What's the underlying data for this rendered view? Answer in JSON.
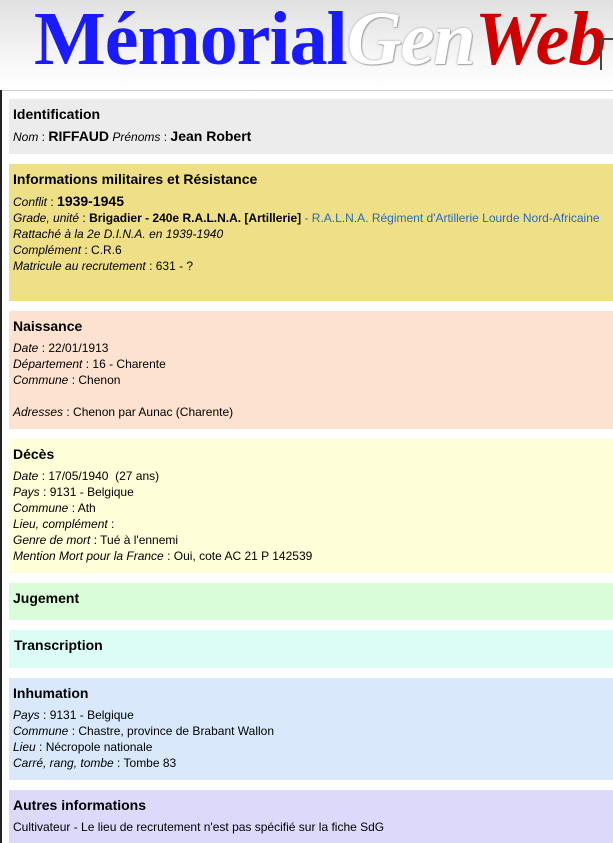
{
  "header": {
    "logo_part1": "Mémorial",
    "logo_part2": "Gen",
    "logo_part3": "Web"
  },
  "identification": {
    "title": "Identification",
    "nom_label": "Nom",
    "nom_value": "RIFFAUD",
    "prenoms_label": "Prénoms",
    "prenoms_value": "Jean Robert"
  },
  "militaire": {
    "title": "Informations militaires et Résistance",
    "conflit_label": "Conflit",
    "conflit_value": "1939-1945",
    "grade_label": "Grade, unité",
    "grade_value": "Brigadier - 240e R.A.L.N.A. [Artillerie]",
    "grade_link": "- R.A.L.N.A. Régiment d'Artillerie Lourde Nord-Africaine",
    "rattache": "Rattaché à la 2e D.I.N.A. en 1939-1940",
    "complement_label": "Complément",
    "complement_value": "C.R.6",
    "matricule_label": "Matricule au recrutement",
    "matricule_value": "631 - ?"
  },
  "naissance": {
    "title": "Naissance",
    "date_label": "Date",
    "date_value": "22/01/1913",
    "departement_label": "Département",
    "departement_value": "16 - Charente",
    "commune_label": "Commune",
    "commune_value": "Chenon",
    "adresses_label": "Adresses",
    "adresses_value": "Chenon par Aunac (Charente)"
  },
  "deces": {
    "title": "Décès",
    "date_label": "Date",
    "date_value": "17/05/1940",
    "age_value": "(27 ans)",
    "pays_label": "Pays",
    "pays_value": "9131 - Belgique",
    "commune_label": "Commune",
    "commune_value": "Ath",
    "lieu_label": "Lieu, complément",
    "lieu_value": "",
    "genre_label": "Genre de mort",
    "genre_value": "Tué à l'ennemi",
    "mention_label": "Mention Mort pour la France",
    "mention_value": "Oui, cote AC 21 P 142539"
  },
  "jugement": {
    "title": "Jugement"
  },
  "transcription": {
    "title": "Transcription"
  },
  "inhumation": {
    "title": "Inhumation",
    "pays_label": "Pays",
    "pays_value": "9131 - Belgique",
    "commune_label": "Commune",
    "commune_value": "Chastre, province de Brabant Wallon",
    "lieu_label": "Lieu",
    "lieu_value": "Nécropole nationale",
    "carre_label": "Carré, rang, tombe",
    "carre_value": "Tombe 83"
  },
  "autres": {
    "title": "Autres informations",
    "text": "Cultivateur - Le lieu de recrutement n'est pas spécifié sur la fiche SdG"
  }
}
